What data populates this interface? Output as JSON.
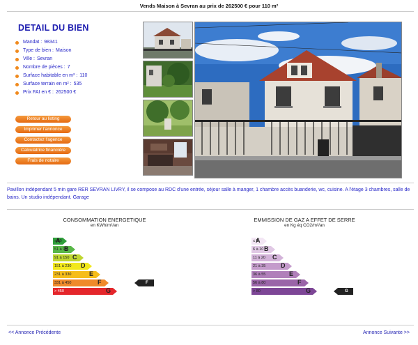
{
  "header": {
    "title": "Vends Maison à Sevran au prix de 262500 € pour 110 m²"
  },
  "detail": {
    "title": "DETAIL DU BIEN",
    "items": [
      {
        "label": "Mandat :",
        "value": "98341"
      },
      {
        "label": "Type de bien :",
        "value": "Maison"
      },
      {
        "label": "Ville :",
        "value": "Sevran"
      },
      {
        "label": "Nombre de pièces :",
        "value": "7"
      },
      {
        "label": "Surface habitable en m² :",
        "value": "110"
      },
      {
        "label": "Surface terrain en m² :",
        "value": "535"
      },
      {
        "label": "Prix FAI en € :",
        "value": "262500 €"
      }
    ]
  },
  "buttons": {
    "listing": "Retour au listing",
    "print": "Imprimer l'annonce",
    "contact": "Contactez l'agence",
    "calculator": "Calculatrice financière",
    "notary": "Frais de notaire"
  },
  "description": "Pavillon indépendant 5 min gare RER SEVRAN LIVRY, il se compose au RDC d'une entrée, séjour salle à manger, 1 chambre accès buanderie, wc, cuisine. A l'étage 3 chambres, salle de bains. Un studio indépendant. Garage",
  "energy": {
    "title": "CONSOMMATION ENERGETIQUE",
    "unit": "en KWh/m²/an",
    "rating": "F",
    "bands": [
      {
        "range": "≤ 50",
        "letter": "A",
        "color": "#2e9e3a"
      },
      {
        "range": "51 à 90",
        "letter": "B",
        "color": "#59b748"
      },
      {
        "range": "91 à 150",
        "letter": "C",
        "color": "#bfd630"
      },
      {
        "range": "151 à 230",
        "letter": "D",
        "color": "#f2e81b"
      },
      {
        "range": "231 à 330",
        "letter": "E",
        "color": "#f6bd1a"
      },
      {
        "range": "331 à 450",
        "letter": "F",
        "color": "#ef8a2a"
      },
      {
        "range": "> 450",
        "letter": "G",
        "color": "#e4262b"
      }
    ]
  },
  "gas": {
    "title": "EMMISSION DE GAZ A EFFET DE SERRE",
    "unit": "en Kg éq CO2/m²/an",
    "rating": "G",
    "bands": [
      {
        "range": "≤ 5",
        "letter": "A",
        "color": "#f3e6f4"
      },
      {
        "range": "6 à 10",
        "letter": "B",
        "color": "#e1c9e5"
      },
      {
        "range": "11 à 20",
        "letter": "C",
        "color": "#d3b3d9"
      },
      {
        "range": "21 à 35",
        "letter": "D",
        "color": "#c49bcb"
      },
      {
        "range": "36 à 55",
        "letter": "E",
        "color": "#b07fba"
      },
      {
        "range": "56 à 80",
        "letter": "F",
        "color": "#9a64a8"
      },
      {
        "range": "> 80",
        "letter": "G",
        "color": "#7d4696"
      }
    ]
  },
  "nav": {
    "prev": "<< Annonce Précédente",
    "next": "Annonce Suivante >>"
  }
}
